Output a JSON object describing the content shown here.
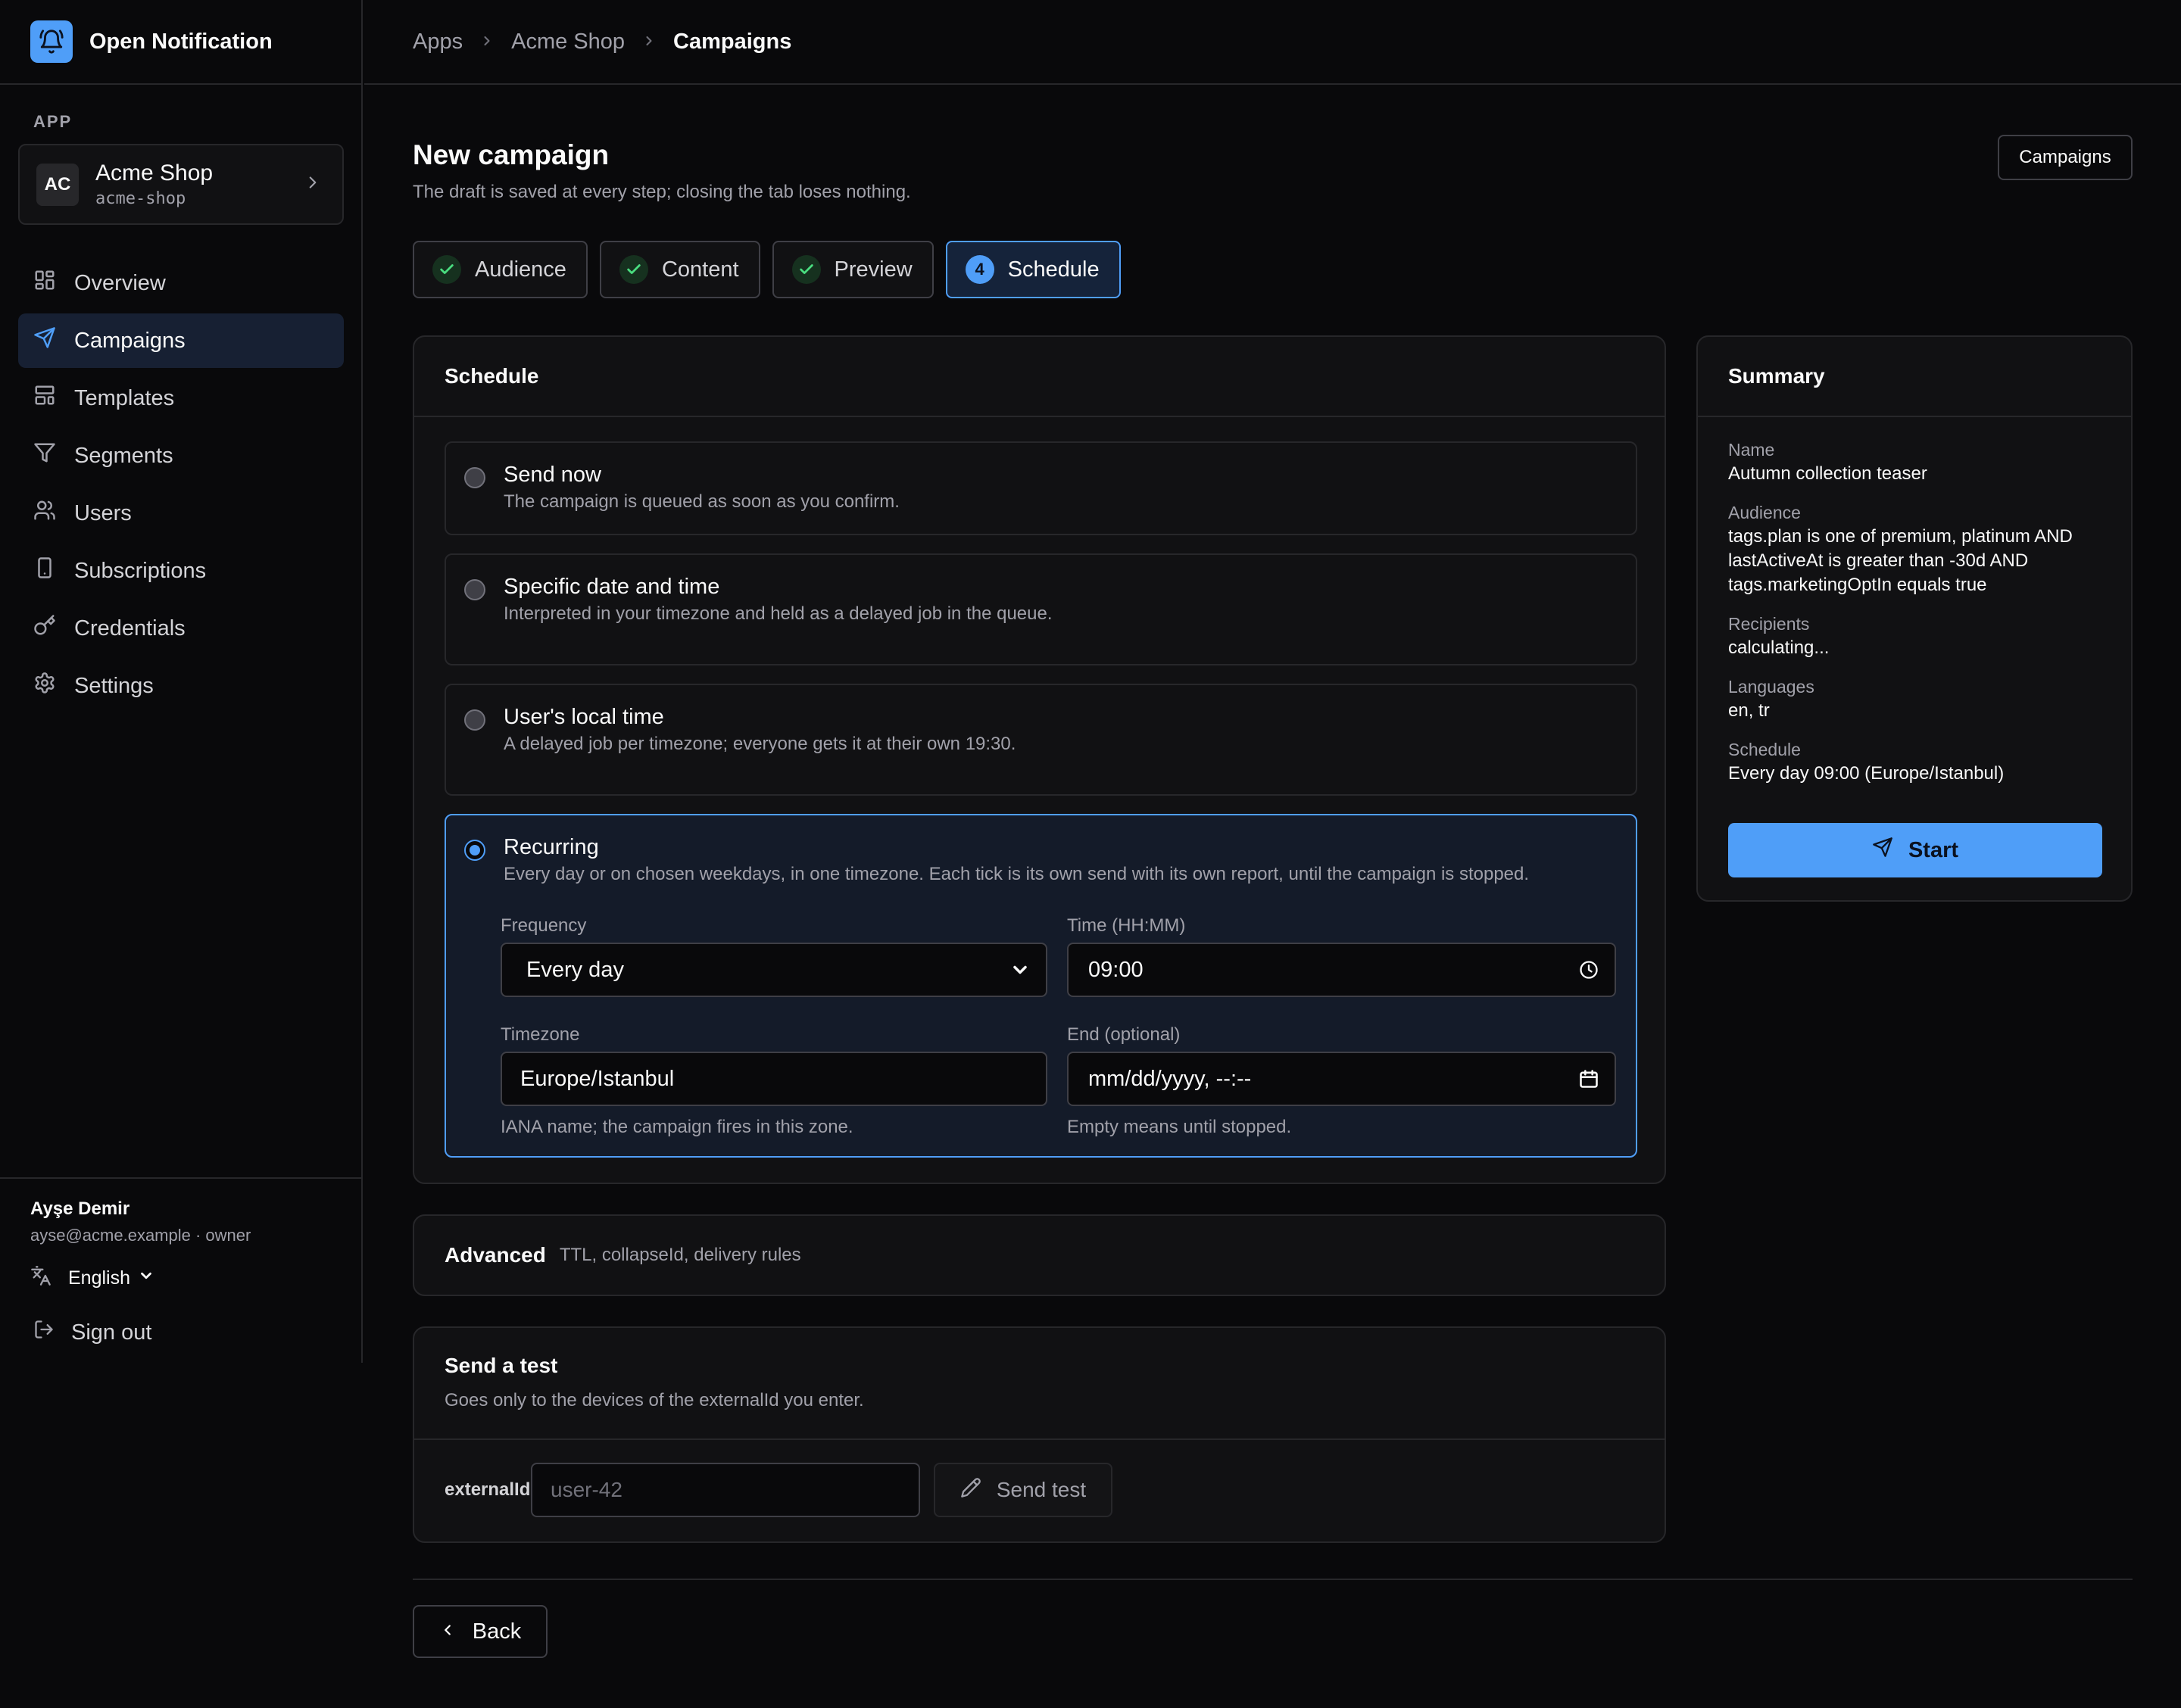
{
  "brand": {
    "name": "Open Notification",
    "icon": "bell-icon",
    "accent": "#4f9ef8"
  },
  "sidebar": {
    "section_label": "APP",
    "app": {
      "initials": "AC",
      "name": "Acme Shop",
      "slug": "acme-shop"
    },
    "items": [
      {
        "label": "Overview",
        "icon": "grid-icon",
        "active": false
      },
      {
        "label": "Campaigns",
        "icon": "send-icon",
        "active": true
      },
      {
        "label": "Templates",
        "icon": "template-icon",
        "active": false
      },
      {
        "label": "Segments",
        "icon": "filter-icon",
        "active": false
      },
      {
        "label": "Users",
        "icon": "users-icon",
        "active": false
      },
      {
        "label": "Subscriptions",
        "icon": "device-icon",
        "active": false
      },
      {
        "label": "Credentials",
        "icon": "key-icon",
        "active": false
      },
      {
        "label": "Settings",
        "icon": "gear-icon",
        "active": false
      }
    ],
    "user": {
      "name": "Ayşe Demir",
      "meta": "ayse@acme.example · owner"
    },
    "language": "English",
    "sign_out": "Sign out"
  },
  "breadcrumb": [
    "Apps",
    "Acme Shop",
    "Campaigns"
  ],
  "header": {
    "title": "New campaign",
    "subtitle": "The draft is saved at every step; closing the tab loses nothing.",
    "campaigns_button": "Campaigns"
  },
  "steps": [
    {
      "label": "Audience",
      "state": "done"
    },
    {
      "label": "Content",
      "state": "done"
    },
    {
      "label": "Preview",
      "state": "done"
    },
    {
      "label": "Schedule",
      "state": "current",
      "number": "4"
    }
  ],
  "schedule": {
    "title": "Schedule",
    "options": [
      {
        "title": "Send now",
        "desc": "The campaign is queued as soon as you confirm.",
        "selected": false
      },
      {
        "title": "Specific date and time",
        "desc": "Interpreted in your timezone and held as a delayed job in the queue.",
        "selected": false
      },
      {
        "title": "User's local time",
        "desc": "A delayed job per timezone; everyone gets it at their own 19:30.",
        "selected": false
      },
      {
        "title": "Recurring",
        "desc": "Every day or on chosen weekdays, in one timezone. Each tick is its own send with its own report, until the campaign is stopped.",
        "selected": true
      }
    ],
    "recurring": {
      "frequency_label": "Frequency",
      "frequency_value": "Every day",
      "time_label": "Time (HH:MM)",
      "time_value": "09:00",
      "timezone_label": "Timezone",
      "timezone_value": "Europe/Istanbul",
      "timezone_hint": "IANA name; the campaign fires in this zone.",
      "end_label": "End (optional)",
      "end_placeholder": "mm/dd/yyyy, --:--",
      "end_hint": "Empty means until stopped."
    }
  },
  "advanced": {
    "title": "Advanced",
    "subtitle": "TTL, collapseId, delivery rules"
  },
  "test": {
    "title": "Send a test",
    "subtitle": "Goes only to the devices of the externalId you enter.",
    "field_label": "externalId",
    "placeholder": "user-42",
    "button": "Send test"
  },
  "summary": {
    "title": "Summary",
    "name_label": "Name",
    "name_value": "Autumn collection teaser",
    "audience_label": "Audience",
    "audience_lines": [
      "tags.plan is one of premium, platinum AND",
      "lastActiveAt is greater than -30d AND",
      "tags.marketingOptIn equals true"
    ],
    "recipients_label": "Recipients",
    "recipients_value": "calculating...",
    "languages_label": "Languages",
    "languages_value": "en, tr",
    "schedule_label": "Schedule",
    "schedule_value": "Every day 09:00 (Europe/Istanbul)",
    "start_button": "Start"
  },
  "footer": {
    "back_button": "Back"
  }
}
